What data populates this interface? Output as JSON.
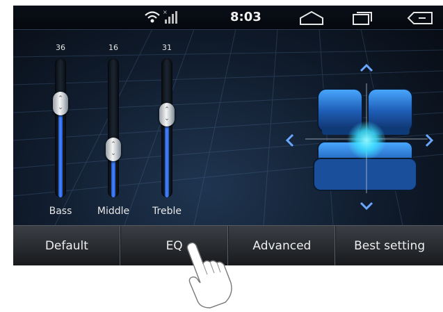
{
  "status_bar": {
    "time": "8:03",
    "icons": [
      "wifi-icon",
      "signal-icon",
      "home-icon",
      "recent-apps-icon",
      "back-icon"
    ]
  },
  "equalizer": {
    "sliders": [
      {
        "name": "Bass",
        "value": "36",
        "level": 0.72
      },
      {
        "name": "Middle",
        "value": "16",
        "level": 0.32
      },
      {
        "name": "Treble",
        "value": "31",
        "level": 0.62
      }
    ]
  },
  "balance": {
    "arrows": [
      "chevron-up-icon",
      "chevron-down-icon",
      "chevron-left-icon",
      "chevron-right-icon"
    ]
  },
  "buttons": [
    {
      "label": "Default"
    },
    {
      "label": "EQ"
    },
    {
      "label": "Advanced"
    },
    {
      "label": "Best setting"
    }
  ],
  "colors": {
    "accent": "#3a7bff",
    "glow": "#3de0ff"
  }
}
